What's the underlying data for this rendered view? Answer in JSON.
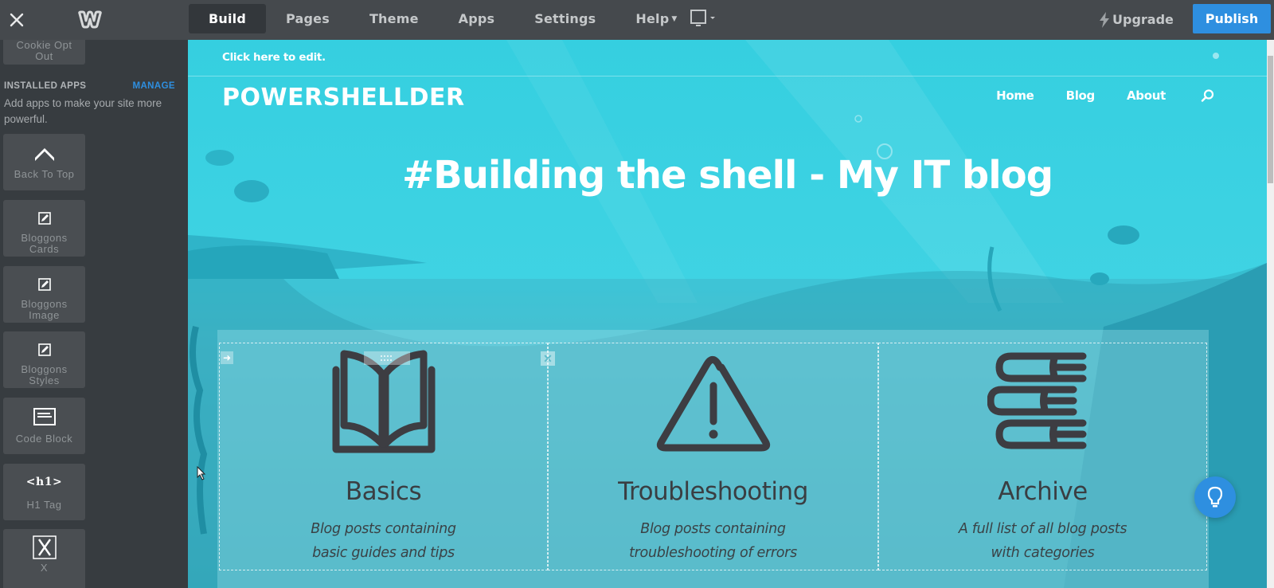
{
  "topbar": {
    "close_icon": "close-icon",
    "logo_icon": "weebly-logo-icon",
    "tabs": [
      {
        "label": "Build",
        "active": true
      },
      {
        "label": "Pages",
        "active": false
      },
      {
        "label": "Theme",
        "active": false
      },
      {
        "label": "Apps",
        "active": false
      },
      {
        "label": "Settings",
        "active": false
      },
      {
        "label": "Help",
        "active": false,
        "dropdown": true
      }
    ],
    "device_icon": "desktop-monitor-icon",
    "upgrade_label": "Upgrade",
    "publish_label": "Publish",
    "colors": {
      "bar": "#45494d",
      "publish": "#2e8fe0"
    }
  },
  "sidebar": {
    "partial_app": {
      "label_line1": "Cookie Opt",
      "label_line2": "Out"
    },
    "section_title": "INSTALLED APPS",
    "manage_label": "MANAGE",
    "description": "Add apps to make your site more powerful.",
    "apps": [
      {
        "label_line1": "Back To Top",
        "label_line2": "",
        "icon": "chevron-up-icon"
      },
      {
        "label_line1": "Bloggons",
        "label_line2": "Cards",
        "icon": "edit-icon"
      },
      {
        "label_line1": "Bloggons",
        "label_line2": "Image",
        "icon": "edit-icon"
      },
      {
        "label_line1": "Bloggons",
        "label_line2": "Styles",
        "icon": "edit-icon"
      },
      {
        "label_line1": "Code Block",
        "label_line2": "",
        "icon": "code-block-icon"
      },
      {
        "label_line1": "H1 Tag",
        "label_line2": "",
        "icon": "h1-tag-icon",
        "icon_text": "<h1>"
      },
      {
        "label_line1": "X",
        "label_line2": "",
        "icon": "x-box-icon"
      }
    ]
  },
  "site": {
    "edit_hint": "Click here to edit.",
    "title": "POWERSHELLDER",
    "nav": [
      "Home",
      "Blog",
      "About"
    ],
    "search_icon": "search-icon",
    "hero": "#Building the shell - My IT blog",
    "features": [
      {
        "title": "Basics",
        "line1": "Blog posts containing",
        "line2": "basic guides and tips",
        "icon": "open-book-icon"
      },
      {
        "title": "Troubleshooting",
        "line1": "Blog posts containing",
        "line2": "troubleshooting of errors",
        "icon": "warning-icon"
      },
      {
        "title": "Archive",
        "line1": "A full list of all blog posts",
        "line2": "with categories",
        "icon": "book-stack-icon"
      }
    ],
    "colors": {
      "sea": "#35cfe0",
      "icon": "#3d3d42"
    }
  },
  "help": {
    "tip_icon": "lightbulb-icon"
  }
}
